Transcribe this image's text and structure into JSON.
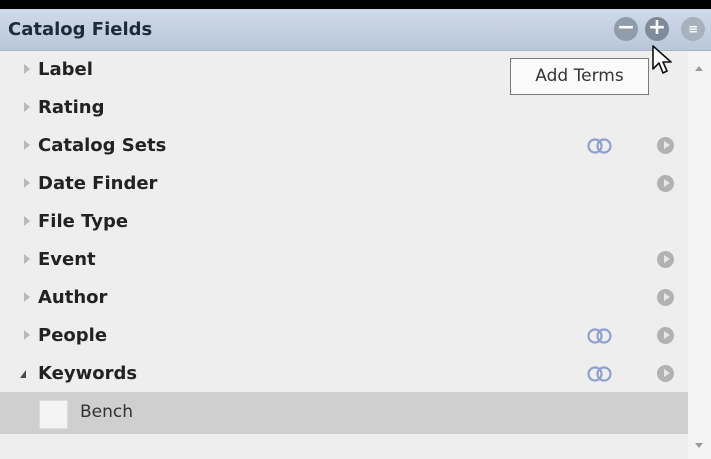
{
  "panel": {
    "title": "Catalog Fields",
    "tooltip": "Add Terms",
    "buttons": {
      "minus": "−",
      "plus": "+",
      "view": "≡"
    }
  },
  "rows": [
    {
      "label": "Label",
      "expanded": false,
      "rings": false,
      "arrow": false
    },
    {
      "label": "Rating",
      "expanded": false,
      "rings": false,
      "arrow": false
    },
    {
      "label": "Catalog Sets",
      "expanded": false,
      "rings": true,
      "arrow": true
    },
    {
      "label": "Date Finder",
      "expanded": false,
      "rings": false,
      "arrow": true
    },
    {
      "label": "File Type",
      "expanded": false,
      "rings": false,
      "arrow": false
    },
    {
      "label": "Event",
      "expanded": false,
      "rings": false,
      "arrow": true
    },
    {
      "label": "Author",
      "expanded": false,
      "rings": false,
      "arrow": true
    },
    {
      "label": "People",
      "expanded": false,
      "rings": true,
      "arrow": true
    },
    {
      "label": "Keywords",
      "expanded": true,
      "rings": true,
      "arrow": true
    }
  ],
  "keyword_items": [
    {
      "label": "Bench",
      "checked": false
    }
  ],
  "icons": {
    "expand": "triangle-right-icon",
    "collapse": "triangle-down-icon",
    "rings": "linked-rings-icon",
    "arrow": "play-arrow-icon",
    "cursor": "mouse-pointer-icon"
  },
  "colors": {
    "header": "#c3cfde",
    "panel_bg": "#eeeeee",
    "selected_row": "#cfcfcf",
    "rings": "#8e9fd0"
  }
}
